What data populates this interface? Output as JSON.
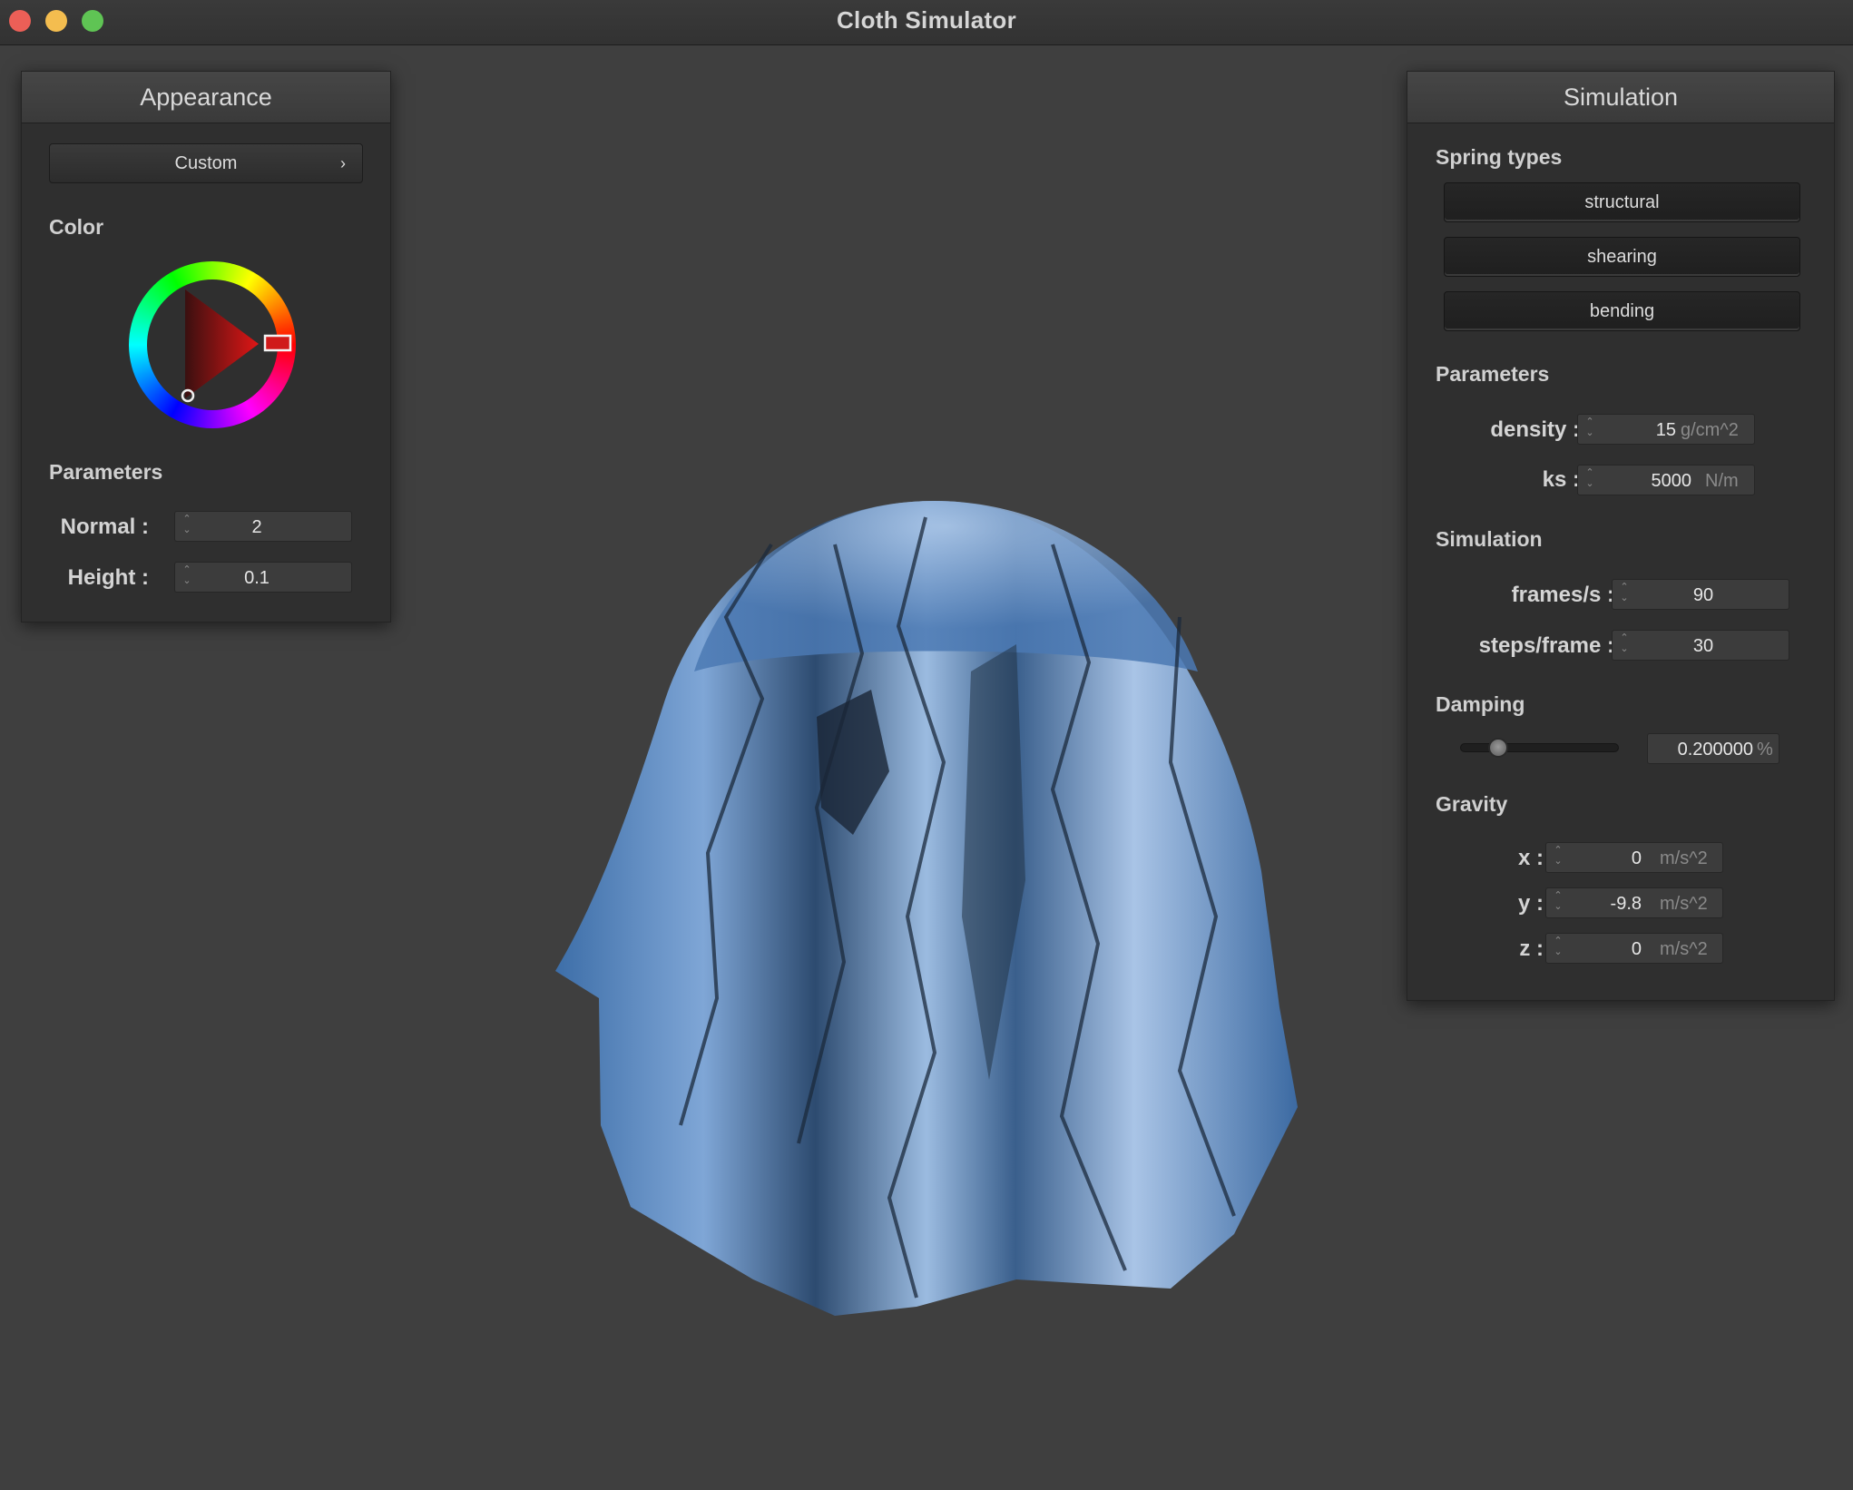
{
  "window": {
    "title": "Cloth Simulator"
  },
  "appearance": {
    "header": "Appearance",
    "preset_label": "Custom",
    "color_label": "Color",
    "color": "#e01616",
    "parameters_label": "Parameters",
    "normal_label": "Normal :",
    "normal_value": "2",
    "height_label": "Height :",
    "height_value": "0.1"
  },
  "simulation": {
    "header": "Simulation",
    "spring_types_label": "Spring types",
    "spring_buttons": [
      "structural",
      "shearing",
      "bending"
    ],
    "parameters_label": "Parameters",
    "density_label": "density :",
    "density_value": "15",
    "density_unit": "g/cm^2",
    "ks_label": "ks :",
    "ks_value": "5000",
    "ks_unit": "N/m",
    "simulation_label": "Simulation",
    "fps_label": "frames/s :",
    "fps_value": "90",
    "steps_label": "steps/frame :",
    "steps_value": "30",
    "damping_label": "Damping",
    "damping_value": "0.200000",
    "damping_unit": "%",
    "damping_fraction": 0.2,
    "gravity_label": "Gravity",
    "gravity_x_label": "x :",
    "gravity_x_value": "0",
    "gravity_y_label": "y :",
    "gravity_y_value": "-9.8",
    "gravity_z_label": "z :",
    "gravity_z_value": "0",
    "gravity_unit": "m/s^2"
  }
}
